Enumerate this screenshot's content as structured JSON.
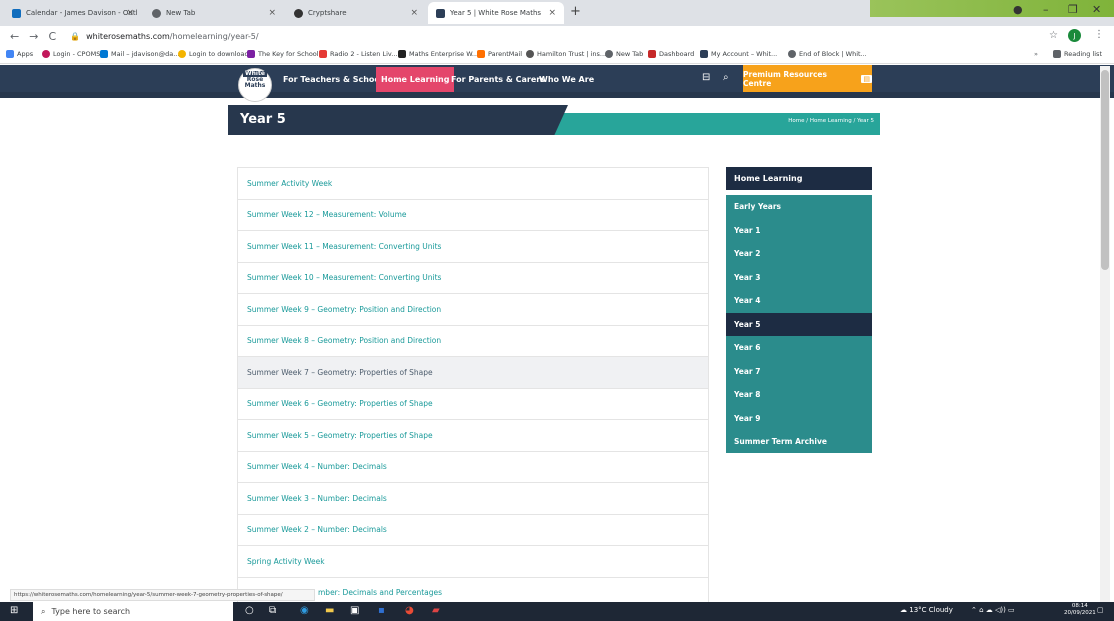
{
  "tabs": [
    {
      "title": "Calendar - James Davison - Outl",
      "color": "#0f6cbd"
    },
    {
      "title": "New Tab",
      "color": "#5f6368"
    },
    {
      "title": "Cryptshare",
      "color": "#333"
    },
    {
      "title": "Year 5 | White Rose Maths",
      "color": "#2c3e57"
    }
  ],
  "url": {
    "host": "whiterosemaths.com",
    "path": "/homelearning/year-5/"
  },
  "bookmarks": [
    {
      "label": "Apps",
      "color": "#4285f4"
    },
    {
      "label": "Login - CPOMS",
      "color": "#c2185b"
    },
    {
      "label": "Mail – jdavison@da...",
      "color": "#0078d4"
    },
    {
      "label": "Login to download...",
      "color": "#f4b400"
    },
    {
      "label": "The Key for School...",
      "color": "#7b1fa2"
    },
    {
      "label": "Radio 2 - Listen Liv...",
      "color": "#e53935"
    },
    {
      "label": "Maths Enterprise W...",
      "color": "#222"
    },
    {
      "label": "ParentMail",
      "color": "#ff6f00"
    },
    {
      "label": "Hamilton Trust | ins...",
      "color": "#555"
    },
    {
      "label": "New Tab",
      "color": "#5f6368"
    },
    {
      "label": "Dashboard",
      "color": "#c62828"
    },
    {
      "label": "My Account – Whit...",
      "color": "#2c3e57"
    },
    {
      "label": "End of Block | Whit...",
      "color": "#5f6368"
    },
    {
      "label": "Reading list",
      "color": "#5f6368"
    }
  ],
  "logo": {
    "line1": "White",
    "line2": "Rose",
    "line3": "Maths"
  },
  "nav": [
    {
      "label": "For Teachers & Schools"
    },
    {
      "label": "Home Learning"
    },
    {
      "label": "For Parents & Carers"
    },
    {
      "label": "Who We Are"
    }
  ],
  "premium": {
    "label": "Premium Resources Centre"
  },
  "page": {
    "title": "Year 5",
    "breadcrumb": "Home / Home Learning / Year 5"
  },
  "weeks": [
    "Summer Activity Week",
    "Summer Week 12 – Measurement: Volume",
    "Summer Week 11 – Measurement: Converting Units",
    "Summer Week 10 – Measurement: Converting Units",
    "Summer Week 9 – Geometry: Position and Direction",
    "Summer Week 8 – Geometry: Position and Direction",
    "Summer Week 7 – Geometry: Properties of Shape",
    "Summer Week 6 – Geometry: Properties of Shape",
    "Summer Week 5 – Geometry: Properties of Shape",
    "Summer Week 4 – Number: Decimals",
    "Summer Week 3 – Number: Decimals",
    "Summer Week 2 – Number: Decimals",
    "Spring Activity Week",
    "mber: Decimals and Percentages"
  ],
  "sidebar": {
    "heading": "Home Learning",
    "items": [
      "Early Years",
      "Year 1",
      "Year 2",
      "Year 3",
      "Year 4",
      "Year 5",
      "Year 6",
      "Year 7",
      "Year 8",
      "Year 9",
      "Summer Term Archive"
    ]
  },
  "status_url": "https://whiterosemaths.com/homelearning/year-5/summer-week-7-geometry-properties-of-shape/",
  "taskbar": {
    "search_placeholder": "Type here to search",
    "weather": "13°C Cloudy",
    "time": "08:14",
    "date": "20/09/2021"
  }
}
